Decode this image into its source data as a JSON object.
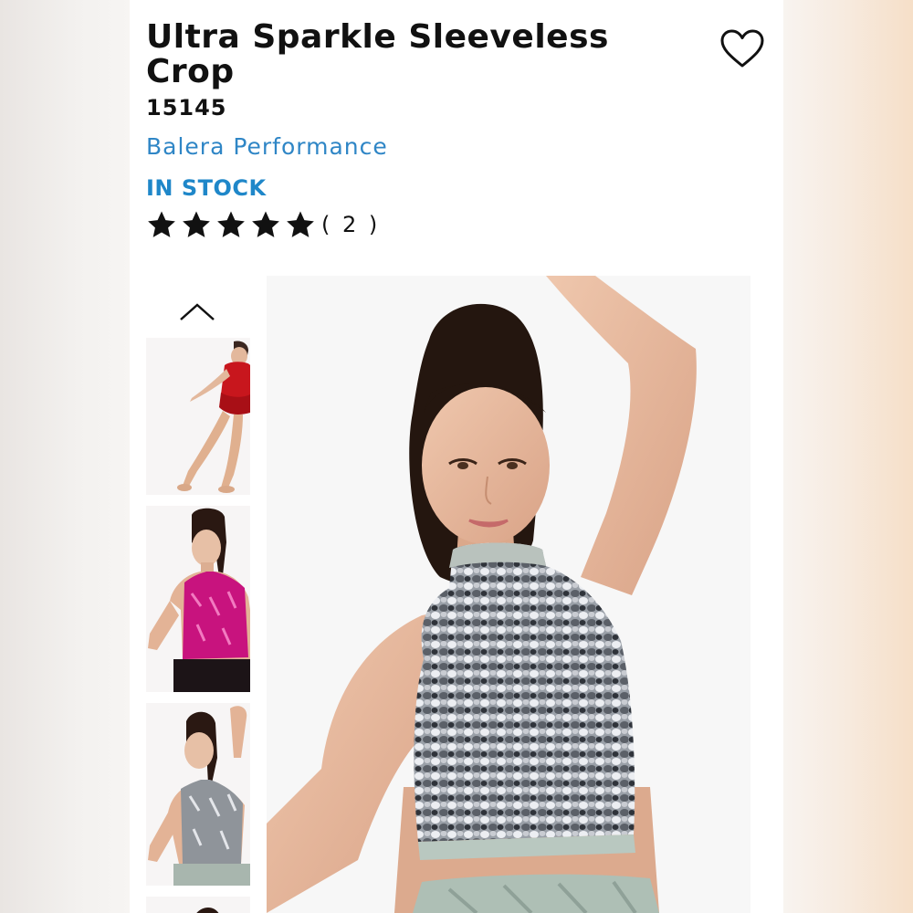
{
  "product": {
    "title": "Ultra Sparkle Sleeveless Crop",
    "sku": "15145",
    "brand": "Balera Performance",
    "stock_status": "IN STOCK",
    "rating": {
      "stars": 5,
      "review_count": "( 2 )"
    }
  },
  "icons": {
    "favorite": "heart-outline-icon",
    "gallery_prev": "chevron-up-icon",
    "rating_star": "star-filled-icon"
  },
  "colors": {
    "brand_link": "#2f86c6",
    "stock": "#1f87c9",
    "text": "#111111"
  },
  "gallery": {
    "thumbnails": [
      {
        "variant": "red"
      },
      {
        "variant": "fuchsia"
      },
      {
        "variant": "silver"
      },
      {
        "variant": "partial"
      }
    ],
    "main_variant": "silver"
  }
}
